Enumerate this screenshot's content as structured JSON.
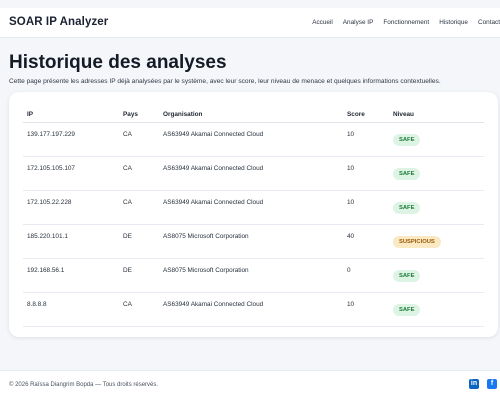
{
  "navbar": {
    "brand": "SOAR IP Analyzer",
    "links": [
      "Accueil",
      "Analyse IP",
      "Fonctionnement",
      "Historique",
      "Contact"
    ]
  },
  "page": {
    "title": "Historique des analyses",
    "intro": "Cette page présente les adresses IP déjà analysées par le système, avec leur score, leur niveau de menace et quelques informations contextuelles."
  },
  "table": {
    "headers": [
      "IP",
      "Pays",
      "Organisation",
      "Score",
      "Niveau"
    ],
    "rows": [
      {
        "ip": "139.177.197.229",
        "pays": "CA",
        "org": "AS63949 Akamai Connected Cloud",
        "score": "10",
        "niveau": "SAFE"
      },
      {
        "ip": "172.105.105.107",
        "pays": "CA",
        "org": "AS63949 Akamai Connected Cloud",
        "score": "10",
        "niveau": "SAFE"
      },
      {
        "ip": "172.105.22.228",
        "pays": "CA",
        "org": "AS63949 Akamai Connected Cloud",
        "score": "10",
        "niveau": "SAFE"
      },
      {
        "ip": "185.220.101.1",
        "pays": "DE",
        "org": "AS8075 Microsoft Corporation",
        "score": "40",
        "niveau": "SUSPICIOUS"
      },
      {
        "ip": "192.168.56.1",
        "pays": "DE",
        "org": "AS8075 Microsoft Corporation",
        "score": "0",
        "niveau": "SAFE"
      },
      {
        "ip": "8.8.8.8",
        "pays": "CA",
        "org": "AS63949 Akamai Connected Cloud",
        "score": "10",
        "niveau": "SAFE"
      }
    ]
  },
  "footer": {
    "text": "© 2026 Raïssa Diangrim Bopda — Tous droits réservés.",
    "social": [
      {
        "icon": "linkedin-icon",
        "glyph": "in"
      },
      {
        "icon": "facebook-icon",
        "glyph": "f"
      }
    ]
  },
  "colors": {
    "safe_bg": "#ddf4e4",
    "safe_text": "#1f7a3a",
    "suspicious_bg": "#fbe9c4",
    "suspicious_text": "#9a5a08"
  }
}
